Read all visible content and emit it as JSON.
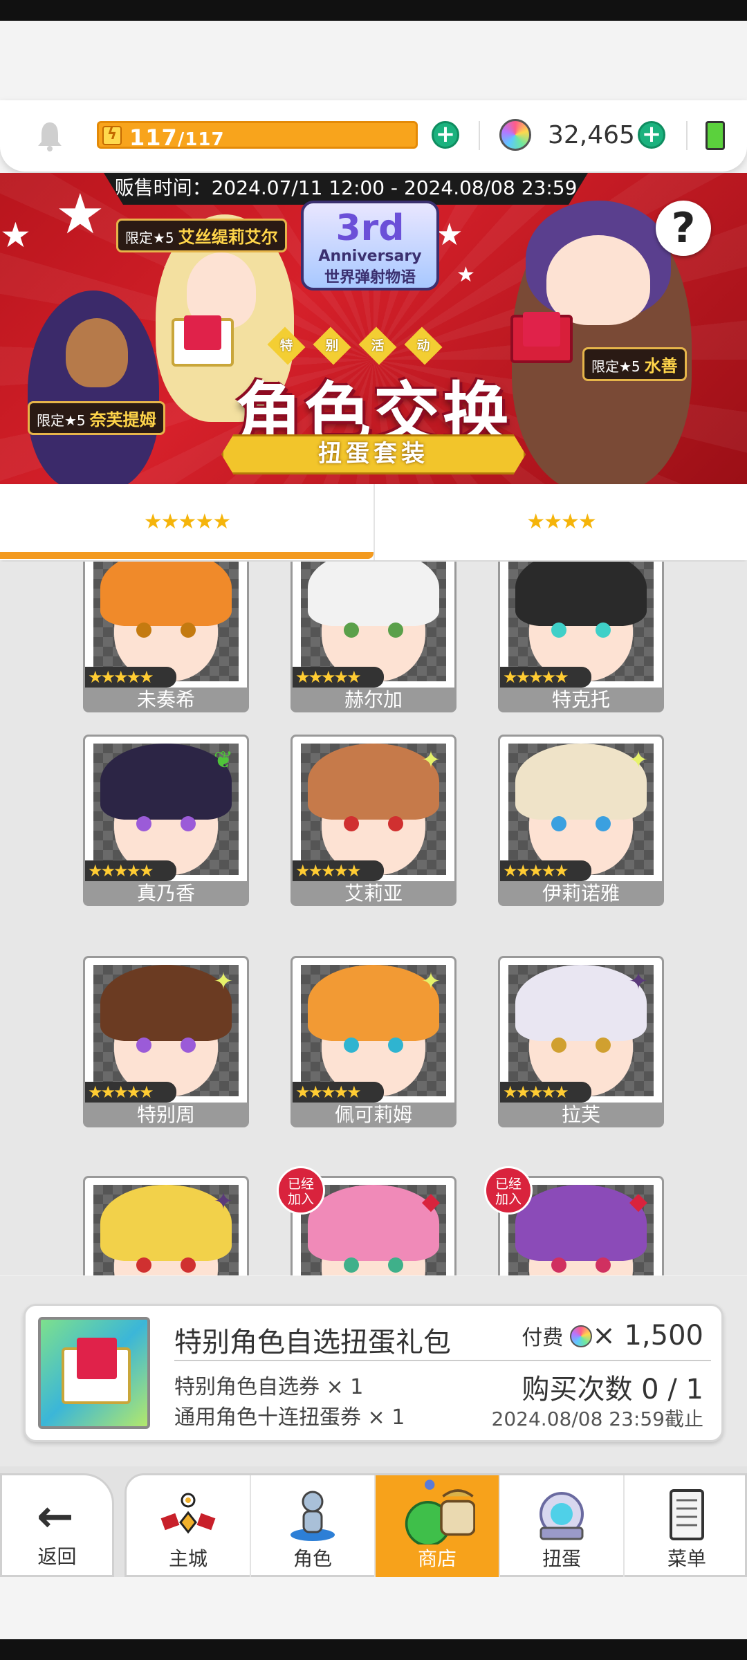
{
  "header": {
    "stamina_current": "117",
    "stamina_max": "/117",
    "stamina_fraction": 1.0,
    "gems": "32,465"
  },
  "banner": {
    "sale_time": "贩售时间：2024.07/11 12:00 - 2024.08/08 23:59",
    "logo_line1": "3rd",
    "logo_line2": "Anniversary",
    "logo_line3": "世界弹射物语",
    "event_chars": [
      "特",
      "别",
      "活",
      "动"
    ],
    "title": "角色交换",
    "subtitle": "扭蛋套装",
    "tags": [
      {
        "prefix": "限定★5",
        "name": "艾丝缇莉艾尔"
      },
      {
        "prefix": "限定★5",
        "name": "水善"
      },
      {
        "prefix": "限定★5",
        "name": "奈芙提姆"
      }
    ],
    "help_label": "?"
  },
  "tabs": [
    {
      "label": "★★★★★",
      "active": true
    },
    {
      "label": "★★★★",
      "active": false
    }
  ],
  "characters": [
    {
      "name": "未奏希",
      "stars": "★★★★★",
      "hair": "#f08a2a",
      "eye": "#c47a10",
      "bg": "#2b2b2b",
      "elem": ""
    },
    {
      "name": "赫尔加",
      "stars": "★★★★★",
      "hair": "#f2f2f2",
      "eye": "#5aa04a",
      "bg": "#cfcfcf",
      "elem": ""
    },
    {
      "name": "特克托",
      "stars": "★★★★★",
      "hair": "#2a2a2a",
      "eye": "#3fd0c8",
      "bg": "#3a3a3a",
      "elem": ""
    },
    {
      "name": "真乃香",
      "stars": "★★★★★",
      "hair": "#2c2545",
      "eye": "#9b5bd8",
      "bg": "#3a3a3a",
      "elem": "leaf",
      "elem_color": "#4fc43a"
    },
    {
      "name": "艾莉亚",
      "stars": "★★★★★",
      "hair": "#c67a4a",
      "eye": "#d03030",
      "bg": "#555555",
      "elem": "spark",
      "elem_color": "#e6f26a"
    },
    {
      "name": "伊莉诺雅",
      "stars": "★★★★★",
      "hair": "#efe3c8",
      "eye": "#3aa0e0",
      "bg": "#555555",
      "elem": "spark",
      "elem_color": "#e6f26a"
    },
    {
      "name": "特别周",
      "stars": "★★★★★",
      "hair": "#6b3b22",
      "eye": "#9b5bd8",
      "bg": "#555555",
      "elem": "spark",
      "elem_color": "#e6f26a"
    },
    {
      "name": "佩可莉姆",
      "stars": "★★★★★",
      "hair": "#f29a34",
      "eye": "#2fb4d0",
      "bg": "#555555",
      "elem": "spark",
      "elem_color": "#e6f26a"
    },
    {
      "name": "拉芙",
      "stars": "★★★★★",
      "hair": "#e9e6f2",
      "eye": "#d0a030",
      "bg": "#6b6bb0",
      "elem": "dark",
      "elem_color": "#5a3a7a"
    },
    {
      "name": "",
      "stars": "",
      "hair": "#f2d14a",
      "eye": "#d03030",
      "bg": "#555555",
      "elem": "dark",
      "elem_color": "#5a3a7a",
      "joined": false
    },
    {
      "name": "",
      "stars": "",
      "hair": "#f08ab8",
      "eye": "#3fb08a",
      "bg": "#555555",
      "elem": "fire",
      "elem_color": "#d9233d",
      "joined": true
    },
    {
      "name": "",
      "stars": "",
      "hair": "#8b4bb8",
      "eye": "#d03060",
      "bg": "#555555",
      "elem": "fire",
      "elem_color": "#d9233d",
      "joined": true
    }
  ],
  "joined_label_1": "已经",
  "joined_label_2": "加入",
  "product": {
    "title": "特别角色自选扭蛋礼包",
    "paid_label": "付费",
    "price": "× 1,500",
    "item1": "特别角色自选券 × 1",
    "item2": "通用角色十连扭蛋券 × 1",
    "buy_count": "购买次数 0 / 1",
    "deadline": "2024.08/08 23:59截止"
  },
  "nav": {
    "back": "返回",
    "items": [
      {
        "label": "主城",
        "icon": "castle-icon"
      },
      {
        "label": "角色",
        "icon": "character-icon"
      },
      {
        "label": "商店",
        "icon": "shop-icon",
        "active": true
      },
      {
        "label": "扭蛋",
        "icon": "gacha-icon"
      },
      {
        "label": "菜单",
        "icon": "menu-icon"
      }
    ]
  }
}
